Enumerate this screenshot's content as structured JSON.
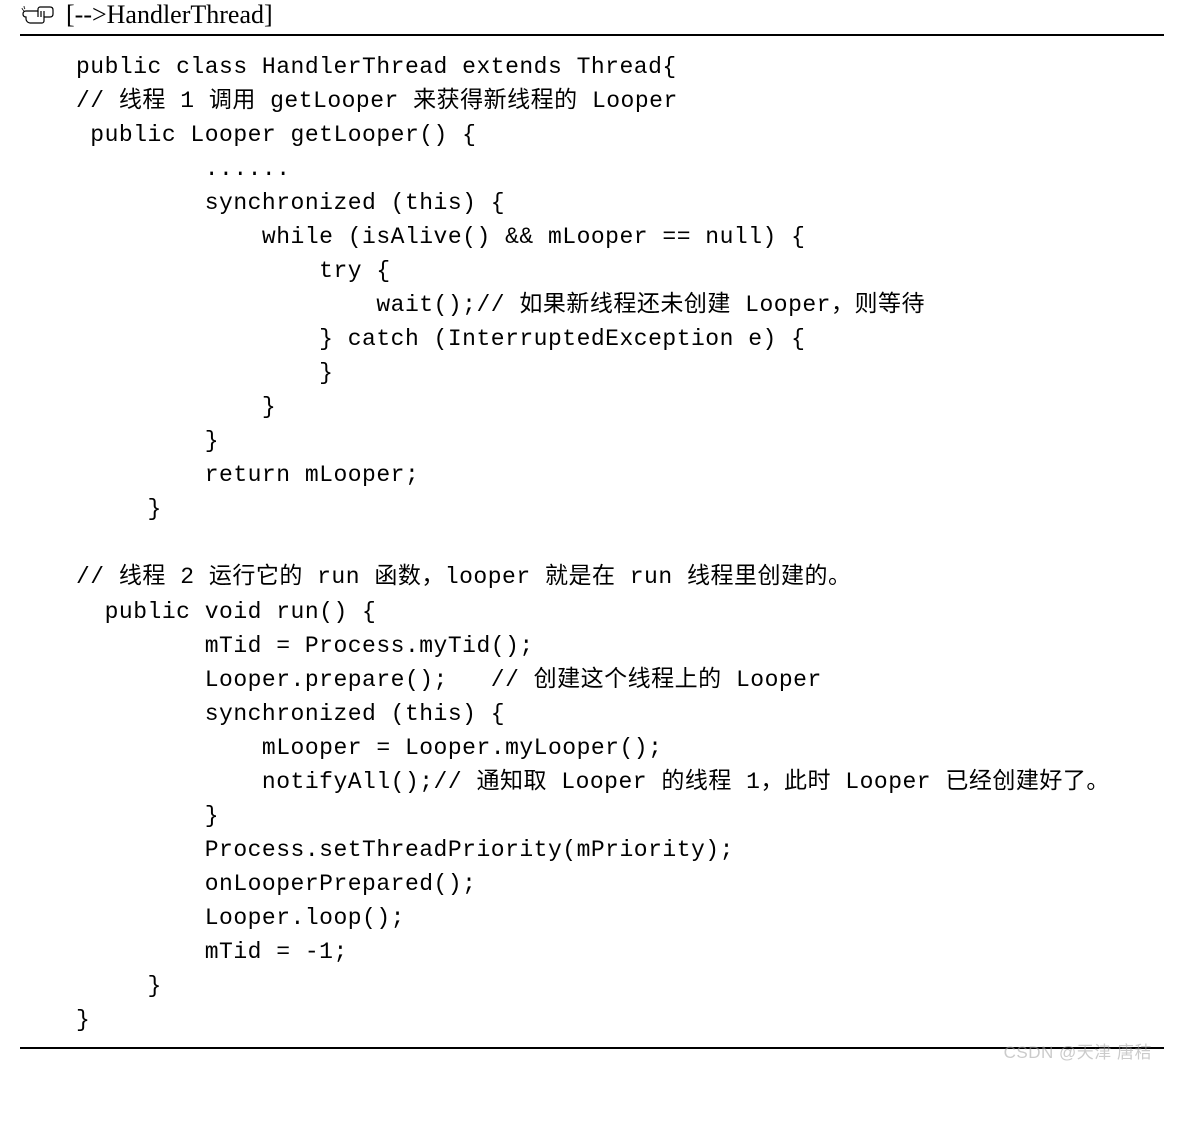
{
  "header": {
    "title": "[-->HandlerThread]"
  },
  "code": {
    "line01": "public class HandlerThread extends Thread{",
    "line02": "// 线程 1 调用 getLooper 来获得新线程的 Looper",
    "line03": " public Looper getLooper() {",
    "line04": "         ......",
    "line05": "         synchronized (this) {",
    "line06": "             while (isAlive() && mLooper == null) {",
    "line07": "                 try {",
    "line08": "                     wait();// 如果新线程还未创建 Looper，则等待",
    "line09": "                 } catch (InterruptedException e) {",
    "line10": "                 }",
    "line11": "             }",
    "line12": "         }",
    "line13": "         return mLooper;",
    "line14": "     }",
    "line15": "",
    "line16": "// 线程 2 运行它的 run 函数，looper 就是在 run 线程里创建的。",
    "line17": "  public void run() {",
    "line18": "         mTid = Process.myTid();",
    "line19": "         Looper.prepare();   // 创建这个线程上的 Looper",
    "line20": "         synchronized (this) {",
    "line21": "             mLooper = Looper.myLooper();",
    "line22": "             notifyAll();// 通知取 Looper 的线程 1，此时 Looper 已经创建好了。",
    "line23": "         }",
    "line24": "         Process.setThreadPriority(mPriority);",
    "line25": "         onLooperPrepared();",
    "line26": "         Looper.loop();",
    "line27": "         mTid = -1;",
    "line28": "     }",
    "line29": "}"
  },
  "watermark": "CSDN @天津 唐秸"
}
